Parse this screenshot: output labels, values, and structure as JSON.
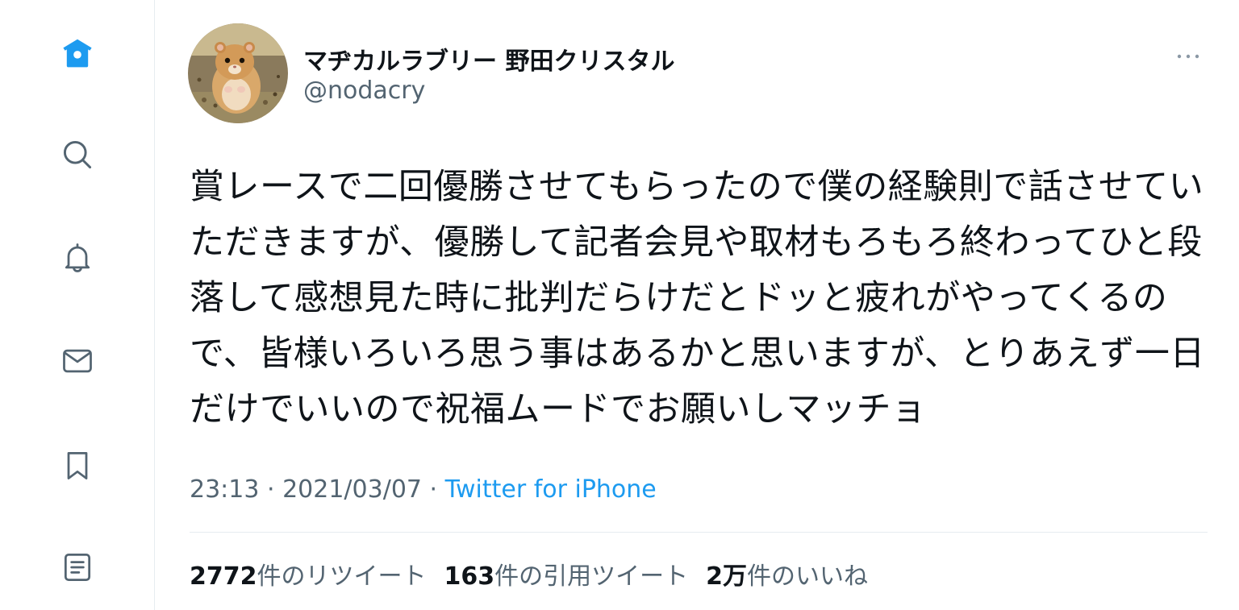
{
  "sidebar": {
    "items": [
      {
        "icon": "home-icon",
        "active": true
      },
      {
        "icon": "search-icon"
      },
      {
        "icon": "bell-icon"
      },
      {
        "icon": "mail-icon"
      },
      {
        "icon": "bookmark-icon"
      },
      {
        "icon": "list-icon"
      }
    ],
    "active_color": "#1d9bf0",
    "icon_color": "#536471"
  },
  "tweet": {
    "display_name": "マヂカルラブリー 野田クリスタル",
    "handle": "@nodacry",
    "text": "賞レースで二回優勝させてもらったので僕の経験則で話させていただきますが、優勝して記者会見や取材もろもろ終わってひと段落して感想見た時に批判だらけだとドッと疲れがやってくるので、皆様いろいろ思う事はあるかと思いますが、とりあえず一日だけでいいので祝福ムードでお願いしマッチョ",
    "time": "23:13",
    "separator": " · ",
    "date": "2021/03/07",
    "source": "Twitter for iPhone",
    "stats": {
      "retweets_count": "2772",
      "retweets_label": "件のリツイート",
      "quotes_count": "163",
      "quotes_label": "件の引用ツイート",
      "likes_count": "2万",
      "likes_label": "件のいいね"
    }
  },
  "colors": {
    "text": "#0f1419",
    "secondary": "#536471",
    "link": "#1d9bf0",
    "border": "#e6ecf0"
  }
}
